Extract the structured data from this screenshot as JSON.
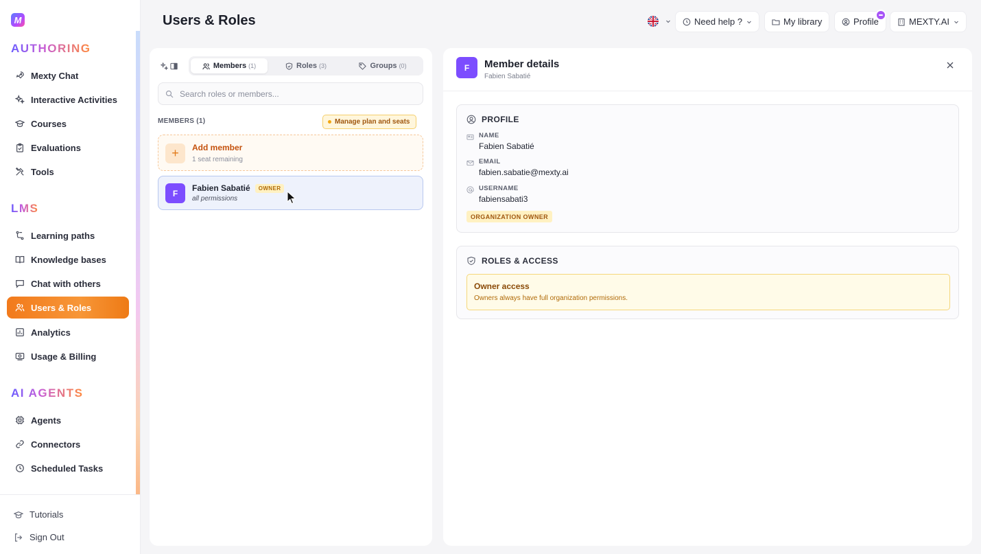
{
  "sidebar": {
    "logo": "M",
    "sections": [
      {
        "title": "AUTHORING",
        "items": [
          {
            "label": "Mexty Chat",
            "icon": "rocket-icon"
          },
          {
            "label": "Interactive Activities",
            "icon": "sparkle-icon"
          },
          {
            "label": "Courses",
            "icon": "graduation-cap-icon"
          },
          {
            "label": "Evaluations",
            "icon": "clipboard-check-icon"
          },
          {
            "label": "Tools",
            "icon": "tools-icon"
          }
        ]
      },
      {
        "title": "LMS",
        "items": [
          {
            "label": "Learning paths",
            "icon": "route-icon"
          },
          {
            "label": "Knowledge bases",
            "icon": "book-open-icon"
          },
          {
            "label": "Chat with others",
            "icon": "chat-bubble-icon"
          },
          {
            "label": "Users & Roles",
            "icon": "users-icon",
            "active": true
          },
          {
            "label": "Analytics",
            "icon": "bar-chart-icon"
          },
          {
            "label": "Usage & Billing",
            "icon": "billing-icon"
          }
        ]
      },
      {
        "title": "AI AGENTS",
        "items": [
          {
            "label": "Agents",
            "icon": "cpu-icon"
          },
          {
            "label": "Connectors",
            "icon": "link-icon"
          },
          {
            "label": "Scheduled Tasks",
            "icon": "clock-icon"
          }
        ]
      }
    ],
    "footer": [
      {
        "label": "Tutorials",
        "icon": "graduation-cap-icon"
      },
      {
        "label": "Sign Out",
        "icon": "sign-out-icon"
      }
    ]
  },
  "header": {
    "title": "Users & Roles",
    "help_label": "Need help ?",
    "library_label": "My library",
    "profile_label": "Profile",
    "org_label": "MEXTY.AI"
  },
  "members_panel": {
    "tabs": [
      {
        "label": "Members",
        "count": "(1)",
        "active": true
      },
      {
        "label": "Roles",
        "count": "(3)"
      },
      {
        "label": "Groups",
        "count": "(0)"
      }
    ],
    "search_placeholder": "Search roles or members...",
    "members_heading": "MEMBERS (1)",
    "manage_label": "Manage plan and seats",
    "add_member": {
      "title": "Add member",
      "subtitle": "1 seat remaining"
    },
    "members": [
      {
        "initial": "F",
        "name": "Fabien Sabatié",
        "badge": "OWNER",
        "permissions": "all permissions"
      }
    ]
  },
  "details": {
    "initial": "F",
    "title": "Member details",
    "subtitle": "Fabien Sabatié",
    "profile_title": "PROFILE",
    "fields": [
      {
        "label": "NAME",
        "value": "Fabien Sabatié",
        "icon": "id-card-icon"
      },
      {
        "label": "EMAIL",
        "value": "fabien.sabatie@mexty.ai",
        "icon": "mail-icon"
      },
      {
        "label": "USERNAME",
        "value": "fabiensabati3",
        "icon": "at-icon"
      }
    ],
    "org_badge": "ORGANIZATION OWNER",
    "roles_title": "ROLES & ACCESS",
    "owner_access_title": "Owner access",
    "owner_access_text": "Owners always have full organization permissions."
  },
  "colors": {
    "accent": "#f27a1c",
    "avatar": "#7c4dff",
    "notification": "#a855f7"
  }
}
